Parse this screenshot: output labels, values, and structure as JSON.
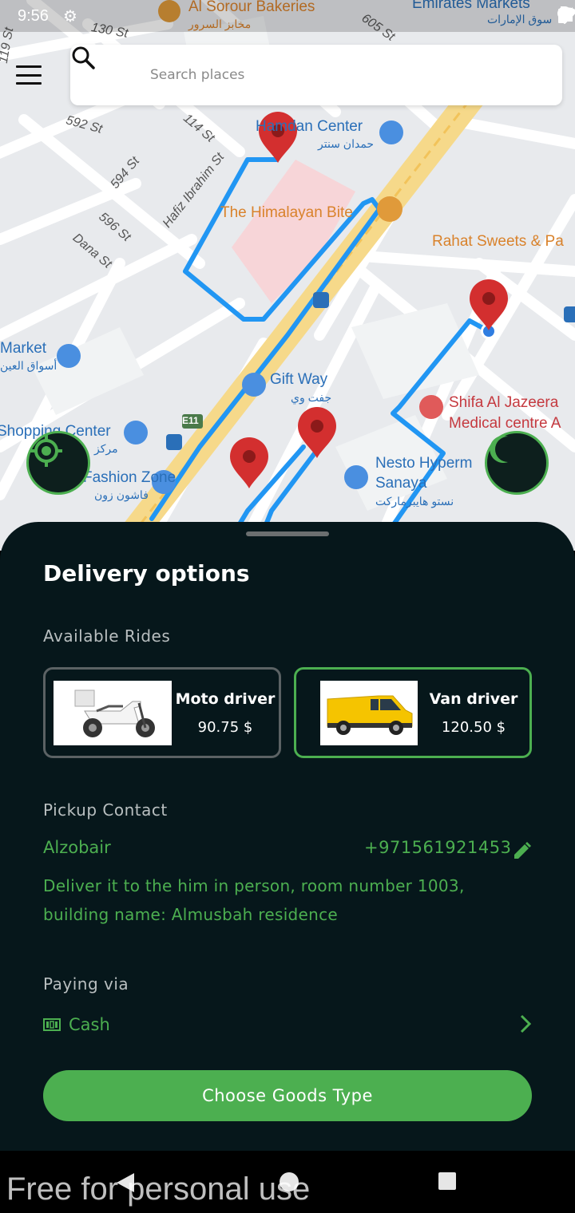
{
  "status_bar": {
    "time": "9:56"
  },
  "search": {
    "placeholder": "Search places"
  },
  "map": {
    "places": [
      {
        "name": "Al Sorour Bakeries",
        "name_ar": "مخابز السرور"
      },
      {
        "name": "Emirates Markets",
        "name_ar": "سوق الإمارات"
      },
      {
        "name": "Hamdan Center",
        "name_ar": "حمدان سنتر"
      },
      {
        "name": "The Himalayan Bite"
      },
      {
        "name": "Rahat Sweets & Pa"
      },
      {
        "name": "Market",
        "name_ar": "أسواق العين"
      },
      {
        "name": "Gift Way",
        "name_ar": "جفت وي"
      },
      {
        "name": "Shifa Al Jazeera",
        "name2": "Medical centre A"
      },
      {
        "name": "Shopping Center",
        "name_ar": "مركز"
      },
      {
        "name": "Fashion Zone",
        "name_ar": "فاشون زون"
      },
      {
        "name": "Nesto Hyperm",
        "name2": "Sanaya",
        "name_ar": "نستو هايبرماركت"
      }
    ],
    "streets": [
      "130 St",
      "119 St",
      "605 St",
      "592 St",
      "114 St",
      "594 St",
      "Hafiz Ibrahim St",
      "596 St",
      "Dana St",
      "E11"
    ]
  },
  "sheet": {
    "title": "Delivery options",
    "available_rides_label": "Available Rides",
    "rides": [
      {
        "name": "Moto driver",
        "price": "90.75 $",
        "selected": false
      },
      {
        "name": "Van driver",
        "price": "120.50 $",
        "selected": true
      }
    ],
    "pickup_contact_label": "Pickup Contact",
    "contact": {
      "name": "Alzobair",
      "phone": "+971561921453",
      "note": "Deliver it to the him in person, room number 1003, building name: Almusbah residence"
    },
    "paying_via_label": "Paying via",
    "payment_method": "Cash",
    "cta_label": "Choose Goods Type"
  },
  "watermark": "Free for personal use",
  "colors": {
    "accent": "#4caf50",
    "sheet_bg": "#06171b",
    "route": "#2196f3",
    "pin": "#d32f2f"
  }
}
